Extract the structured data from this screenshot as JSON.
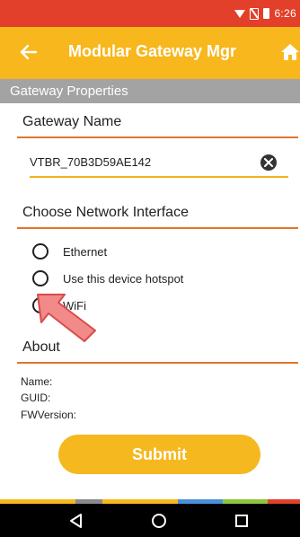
{
  "status_bar": {
    "time": "6:26"
  },
  "app_bar": {
    "title": "Modular Gateway Mgr"
  },
  "section_header": "Gateway Properties",
  "gateway_name": {
    "title": "Gateway Name",
    "value": "VTBR_70B3D59AE142"
  },
  "network": {
    "title": "Choose Network Interface",
    "options": [
      {
        "label": "Ethernet",
        "selected": false
      },
      {
        "label": "Use this device hotspot",
        "selected": false
      },
      {
        "label": "WiFi",
        "selected": false
      }
    ]
  },
  "about": {
    "title": "About",
    "name_label": "Name:",
    "guid_label": "GUID:",
    "fw_label": "FWVersion:"
  },
  "submit_label": "Submit",
  "colors": {
    "status_bar": "#e2402a",
    "app_bar": "#f7b71d",
    "accent_rule": "#e0752a",
    "submit": "#f5b81f",
    "stripe": [
      "#f5b81f",
      "#8a8a8a",
      "#f5b81f",
      "#4a90d9",
      "#8cc63f",
      "#e2402a"
    ]
  },
  "icons": {
    "back": "arrow-left-icon",
    "home": "home-icon",
    "clear": "clear-x-icon",
    "nav": [
      "back-triangle-icon",
      "home-circle-icon",
      "recents-square-icon"
    ]
  }
}
